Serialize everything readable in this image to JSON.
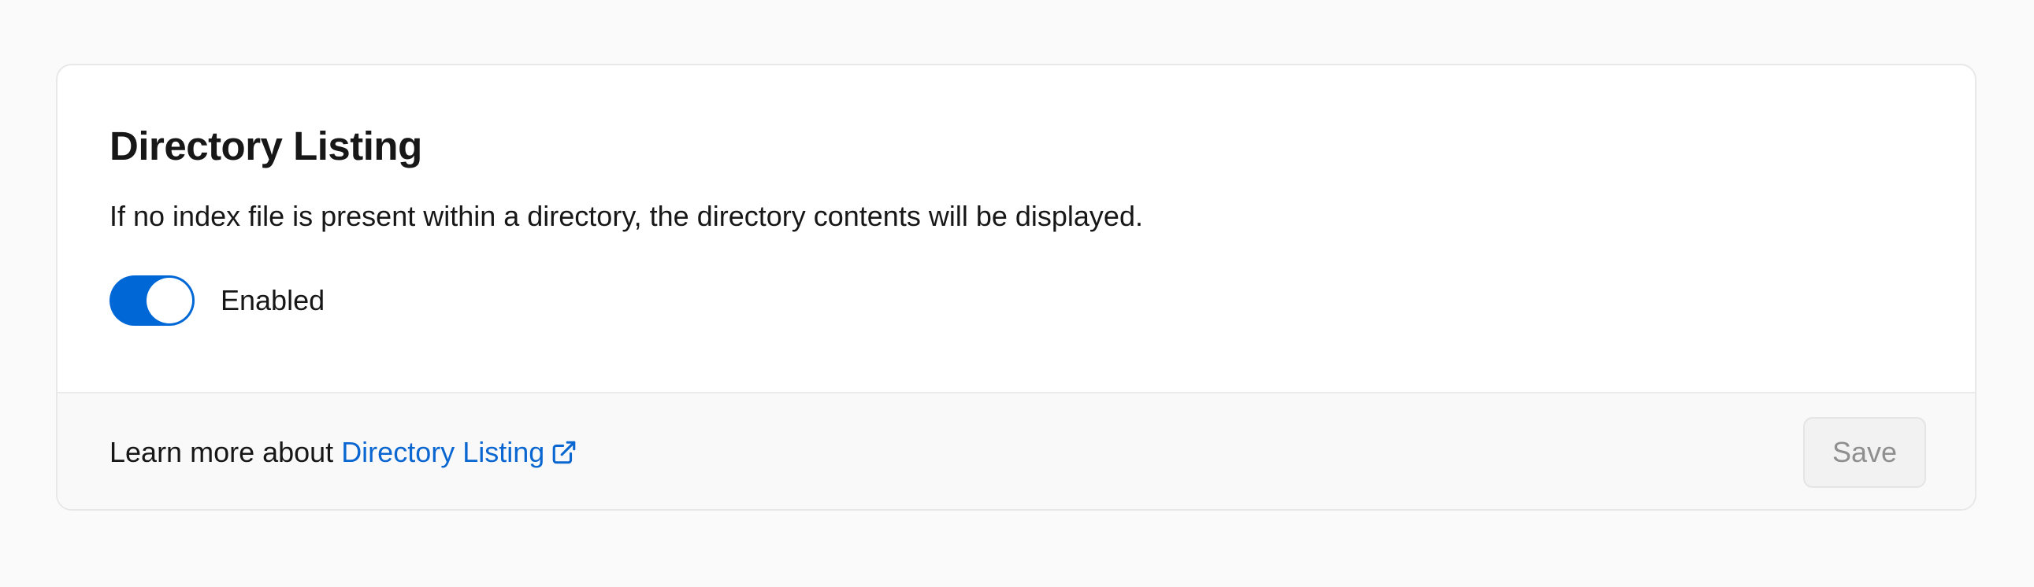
{
  "section": {
    "title": "Directory Listing",
    "description": "If no index file is present within a directory, the directory contents will be displayed.",
    "toggle": {
      "label": "Enabled",
      "state": "on",
      "on_color": "#0068d6"
    }
  },
  "footer": {
    "learn_more_prefix": "Learn more about",
    "learn_more_link": "Directory Listing",
    "link_icon": "external-link-icon",
    "link_color": "#0a67d1",
    "save_label": "Save",
    "save_state": "disabled"
  }
}
